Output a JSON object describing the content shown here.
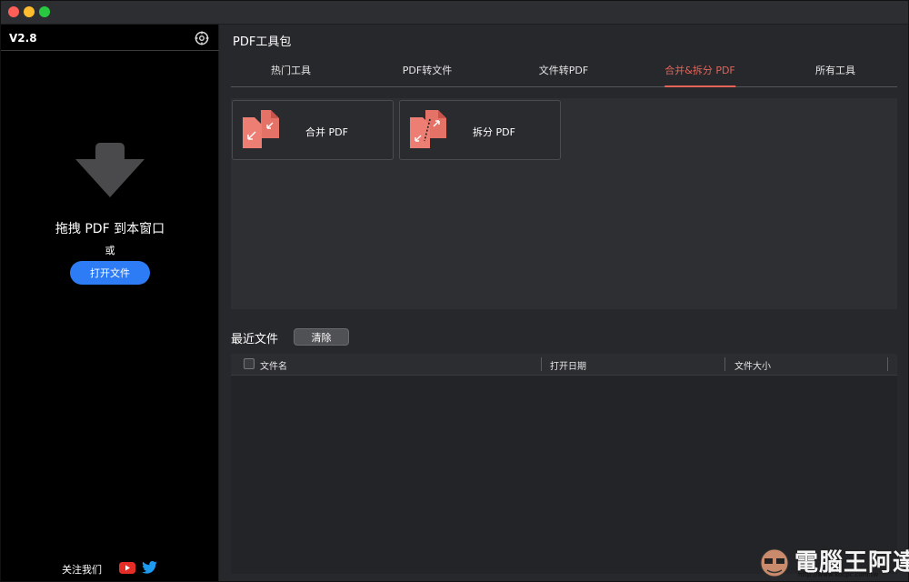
{
  "app": {
    "version": "V2.8"
  },
  "sidebar": {
    "drop_title": "拖拽 PDF 到本窗口",
    "or_text": "或",
    "open_file_label": "打开文件",
    "follow_label": "关注我们",
    "icons": [
      "gear-icon",
      "download-arrow-icon",
      "youtube-icon",
      "twitter-icon"
    ]
  },
  "main": {
    "title": "PDF工具包",
    "tabs": [
      {
        "label": "热门工具",
        "active": false
      },
      {
        "label": "PDF转文件",
        "active": false
      },
      {
        "label": "文件转PDF",
        "active": false
      },
      {
        "label": "合并&拆分 PDF",
        "active": true
      },
      {
        "label": "所有工具",
        "active": false
      }
    ],
    "tools": [
      {
        "label": "合并 PDF",
        "icon": "merge-pdf-icon"
      },
      {
        "label": "拆分 PDF",
        "icon": "split-pdf-icon"
      }
    ]
  },
  "recent": {
    "title": "最近文件",
    "clear_label": "清除",
    "columns": [
      "文件名",
      "打开日期",
      "文件大小"
    ],
    "rows": []
  },
  "watermark": {
    "text": "電腦王阿達",
    "url": "http://www.kocpc.com.tw"
  },
  "colors": {
    "accent": "#e5645a",
    "primary_button": "#2d7cf6",
    "sidebar_bg": "#000000",
    "main_bg": "#27282c"
  }
}
